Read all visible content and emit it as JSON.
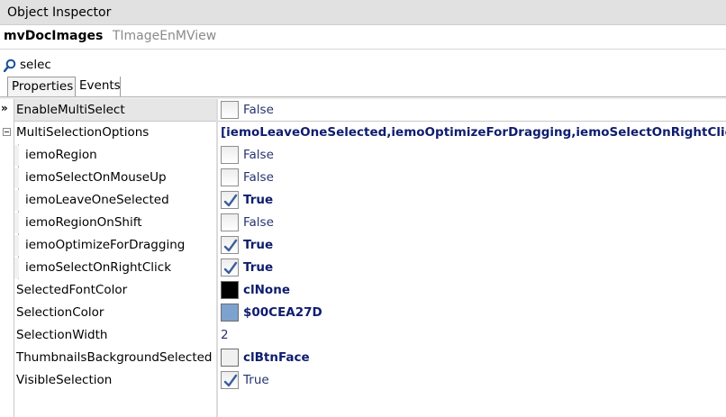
{
  "window": {
    "title": "Object Inspector"
  },
  "object": {
    "name": "mvDocImages",
    "class": "TImageEnMView"
  },
  "search": {
    "value": "selec"
  },
  "tabs": [
    {
      "label": "Properties",
      "active": true
    },
    {
      "label": "Events",
      "active": false
    }
  ],
  "selection_marker": "»",
  "colors": {
    "value_default": "#27336e",
    "value_modified": "#0f1d6e",
    "selected_row": "#e6e6e6",
    "SelectedFontColor_swatch": "#000000",
    "SelectionColor_swatch": "#7DA2CE",
    "ThumbnailsBackgroundSelected_swatch": "#F0F0F0"
  },
  "properties": [
    {
      "name": "EnableMultiSelect",
      "value": "False",
      "editor": "checkbox",
      "checked": false,
      "modified": false,
      "selected": true
    },
    {
      "name": "MultiSelectionOptions",
      "value": "[iemoLeaveOneSelected,iemoOptimizeForDragging,iemoSelectOnRightClick]",
      "editor": "text",
      "modified": true,
      "expandable": true,
      "expanded": true
    },
    {
      "name": "iemoRegion",
      "value": "False",
      "editor": "checkbox",
      "checked": false,
      "modified": false,
      "child": true
    },
    {
      "name": "iemoSelectOnMouseUp",
      "value": "False",
      "editor": "checkbox",
      "checked": false,
      "modified": false,
      "child": true
    },
    {
      "name": "iemoLeaveOneSelected",
      "value": "True",
      "editor": "checkbox",
      "checked": true,
      "modified": true,
      "child": true
    },
    {
      "name": "iemoRegionOnShift",
      "value": "False",
      "editor": "checkbox",
      "checked": false,
      "modified": false,
      "child": true
    },
    {
      "name": "iemoOptimizeForDragging",
      "value": "True",
      "editor": "checkbox",
      "checked": true,
      "modified": true,
      "child": true
    },
    {
      "name": "iemoSelectOnRightClick",
      "value": "True",
      "editor": "checkbox",
      "checked": true,
      "modified": true,
      "child": true
    },
    {
      "name": "SelectedFontColor",
      "value": "clNone",
      "editor": "color",
      "swatch": "#000000",
      "modified": true
    },
    {
      "name": "SelectionColor",
      "value": "$00CEA27D",
      "editor": "color",
      "swatch": "#7DA2CE",
      "modified": true
    },
    {
      "name": "SelectionWidth",
      "value": "2",
      "editor": "text",
      "modified": false
    },
    {
      "name": "ThumbnailsBackgroundSelected",
      "value": "clBtnFace",
      "editor": "color",
      "swatch": "#F0F0F0",
      "modified": true
    },
    {
      "name": "VisibleSelection",
      "value": "True",
      "editor": "checkbox",
      "checked": true,
      "modified": false
    }
  ]
}
